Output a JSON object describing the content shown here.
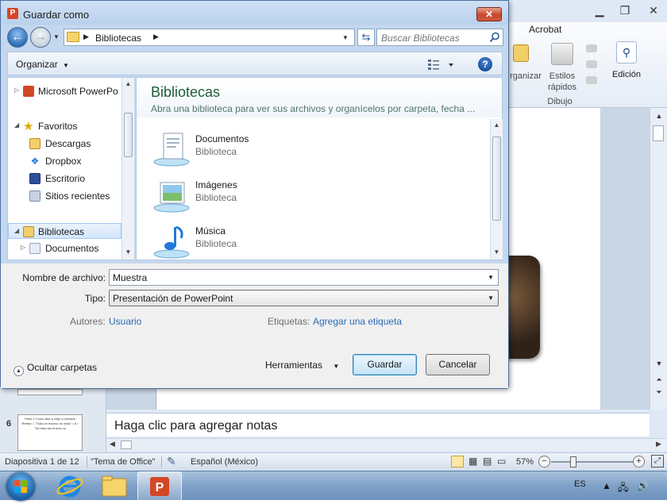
{
  "dialog": {
    "title": "Guardar como",
    "app_icon_letter": "P",
    "close_label": "✕",
    "nav": {
      "address_crumb": "Bibliotecas",
      "search_placeholder": "Buscar Bibliotecas"
    },
    "toolbar": {
      "organize_label": "Organizar",
      "help_label": "?"
    },
    "nav_tree": [
      {
        "label": "Microsoft PowerPo",
        "icon": "powerpoint-icon"
      },
      {
        "label": "Favoritos",
        "icon": "star-icon"
      },
      {
        "label": "Descargas",
        "icon": "downloads-icon"
      },
      {
        "label": "Dropbox",
        "icon": "dropbox-icon"
      },
      {
        "label": "Escritorio",
        "icon": "desktop-icon"
      },
      {
        "label": "Sitios recientes",
        "icon": "recent-places-icon"
      },
      {
        "label": "Bibliotecas",
        "icon": "libraries-icon"
      },
      {
        "label": "Documentos",
        "icon": "documents-icon"
      }
    ],
    "content": {
      "title": "Bibliotecas",
      "subtitle": "Abra una biblioteca para ver sus archivos y organícelos por carpeta, fecha ...",
      "items": [
        {
          "name": "Documentos",
          "type": "Biblioteca",
          "icon": "documents-library-icon"
        },
        {
          "name": "Imágenes",
          "type": "Biblioteca",
          "icon": "pictures-library-icon"
        },
        {
          "name": "Música",
          "type": "Biblioteca",
          "icon": "music-library-icon"
        }
      ]
    },
    "form": {
      "filename_label": "Nombre de archivo:",
      "filename_value": "Muestra",
      "type_label": "Tipo:",
      "type_value": "Presentación de PowerPoint",
      "authors_label": "Autores:",
      "authors_value": "Usuario",
      "tags_label": "Etiquetas:",
      "tags_value": "Agregar una etiqueta",
      "hide_folders_label": "Ocultar carpetas",
      "tools_label": "Herramientas",
      "save_label": "Guardar",
      "cancel_label": "Cancelar"
    }
  },
  "powerpoint": {
    "ribbon": {
      "tab_acrobat": "Acrobat",
      "organize_fragment": "rganizar",
      "quick_styles_line1": "Estilos",
      "quick_styles_line2": "rápidos",
      "group_drawing": "Dibujo",
      "editing_label": "Edición"
    },
    "thumbnails": {
      "slide_number": "6",
      "slide6_text": "Paso 1 Como dice a viejo a versado Refrán: • \"Todo en exceso es malo\" • 6 • \"De esto tan bueno no"
    },
    "notes_placeholder": "Haga clic para agregar notas",
    "status": {
      "slide_info": "Diapositiva 1 de 12",
      "theme": "\"Tema de Office\"",
      "language": "Español (México)",
      "zoom": "57%",
      "zoom_out": "−",
      "zoom_in": "+"
    }
  },
  "taskbar": {
    "language": "ES"
  },
  "colors": {
    "dialog_frame": "#c4d7ee",
    "link_blue": "#2b6cb4",
    "library_title_green": "#1e5d3a",
    "close_red": "#c8452d",
    "powerpoint_orange": "#d24726"
  }
}
